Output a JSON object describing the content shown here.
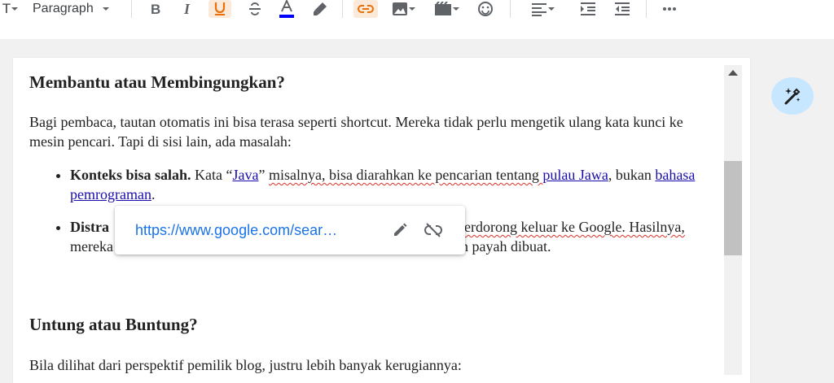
{
  "toolbar": {
    "font_size_label": "T",
    "format_select": "Paragraph",
    "buttons": [
      "bold",
      "italic",
      "underline",
      "strikethrough",
      "text-color",
      "highlight",
      "link",
      "image",
      "video",
      "emoji",
      "align",
      "indent",
      "outdent",
      "more"
    ]
  },
  "colors": {
    "link": "#1a0dab",
    "accent": "#1a73e8",
    "text_color_bar": "#0000ff",
    "active_bg": "#fbe9d9"
  },
  "document": {
    "heading1": "Membantu atau Membingungkan?",
    "para1": "Bagi pembaca, tautan otomatis ini bisa terasa seperti shortcut. Mereka tidak perlu mengetik ulang kata kunci ke mesin pencari. Tapi di sisi lain, ada masalah:",
    "bullet1": {
      "bold": "Konteks bisa salah.",
      "t1": " Kata “",
      "link1": "Java",
      "t2": "” ",
      "t3": "misalnya, bisa diarahkan ke pencarian tentang ",
      "link2": "pulau Jawa",
      "t4": ", bukan ",
      "link3": "bahasa pemrograman",
      "t5": "."
    },
    "bullet2": {
      "bold": "Distra",
      "t1": "",
      "line1_tail": "erdorong keluar ke Google. Hasilnya,",
      "line2_head": "mereka",
      "line2_tail": "h payah dibuat."
    },
    "heading2": "Untung atau Buntung?",
    "para2": "Bila dilihat dari perspektif pemilik blog, justru lebih banyak kerugiannya:"
  },
  "link_popup": {
    "url": "https://www.google.com/sear…"
  }
}
